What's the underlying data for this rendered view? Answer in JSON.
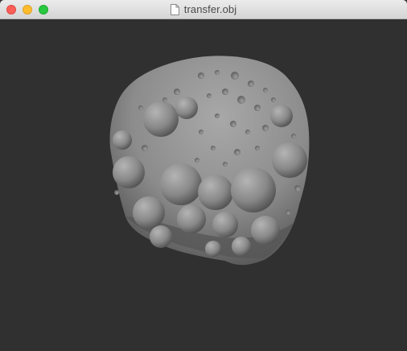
{
  "window": {
    "title": "transfer.obj",
    "title_icon": "document-icon",
    "traffic_lights": [
      "close",
      "minimize",
      "zoom"
    ]
  },
  "viewport": {
    "background": "#303030",
    "model": "asteroid-mesh",
    "model_color": "#8c8c8c"
  }
}
